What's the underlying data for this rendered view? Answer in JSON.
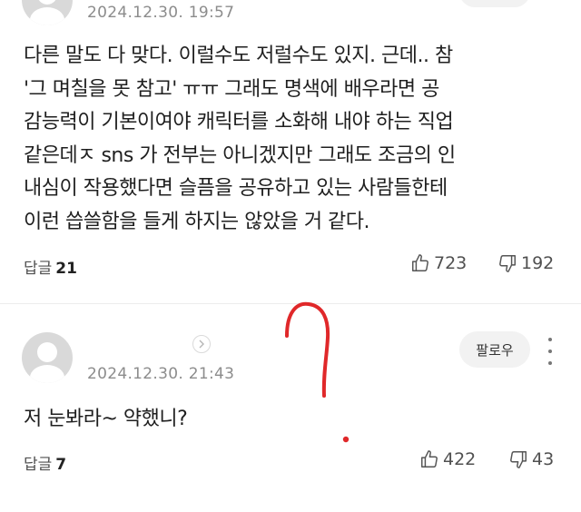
{
  "comment1": {
    "timestamp": "2024.12.30. 19:57",
    "lines": [
      "다른 말도 다 맞다. 이럴수도 저럴수도 있지. 근데.. 참",
      "'그 며칠을 못 참고' ㅠㅠ 그래도 명색에 배우라면 공",
      "감능력이 기본이여야 캐릭터를 소화해 내야 하는 직업",
      "같은데ㅈ sns 가 전부는 아니겠지만 그래도 조금의 인",
      "내심이 작용했다면 슬픔을 공유하고 있는 사람들한테",
      "이런 씁쓸함을 들게 하지는 않았을 거 같다."
    ],
    "reply_label": "답글",
    "reply_count": "21",
    "likes": "723",
    "dislikes": "192"
  },
  "comment2": {
    "timestamp": "2024.12.30. 21:43",
    "follow_label": "팔로우",
    "text": "저 눈봐라~ 약했니?",
    "reply_label": "답글",
    "reply_count": "7",
    "likes": "422",
    "dislikes": "43"
  },
  "icons": {
    "like": "thumbs-up-icon",
    "dislike": "thumbs-down-icon",
    "more": "more-vertical-icon",
    "chevron": "chevron-right-icon",
    "avatar": "default-avatar-icon"
  },
  "colors": {
    "annotation_red": "#e0282a",
    "muted_text": "#8c8c8c",
    "button_bg": "#f2f2f2"
  }
}
